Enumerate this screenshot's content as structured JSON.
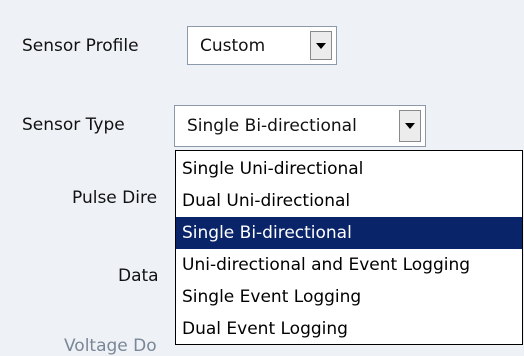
{
  "form": {
    "sensor_profile_label": "Sensor Profile",
    "sensor_profile_value": "Custom",
    "sensor_type_label": "Sensor Type",
    "sensor_type_value": "Single Bi-directional",
    "pulse_direction_label": "Pulse Dire",
    "data_label": "Data",
    "voltage_label": "Voltage Do"
  },
  "dropdown": {
    "options": [
      "Single Uni-directional",
      "Dual Uni-directional",
      "Single Bi-directional",
      "Uni-directional and Event Logging",
      "Single Event Logging",
      "Dual Event Logging"
    ],
    "selected_index": 2
  },
  "colors": {
    "selection_bg": "#0a246a",
    "panel_bg": "#eef1f6"
  }
}
